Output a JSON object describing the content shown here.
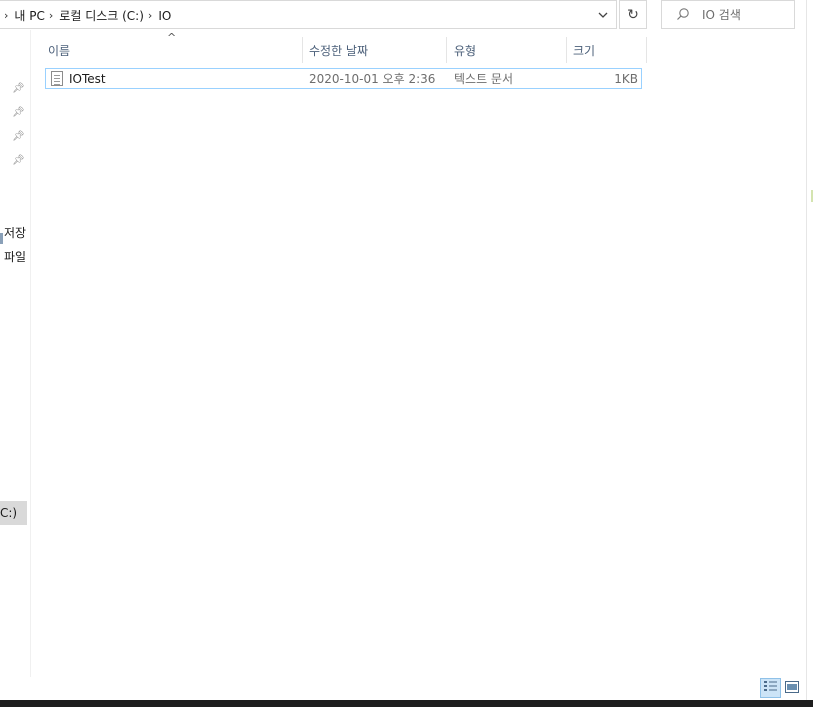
{
  "address_bar": {
    "crumbs": [
      "내 PC",
      "로컬 디스크 (C:)",
      "IO"
    ]
  },
  "search": {
    "placeholder": "IO 검색"
  },
  "nav": {
    "items": [
      "저장",
      "파일"
    ],
    "selected": "C:)"
  },
  "columns": {
    "name": "이름",
    "date_modified": "수정한 날짜",
    "type": "유형",
    "size": "크기"
  },
  "files": [
    {
      "name": "IOTest",
      "date_modified": "2020-10-01 오후 2:36",
      "type": "텍스트 문서",
      "size": "1KB",
      "icon": "text-file-icon"
    }
  ],
  "icons": {
    "refresh": "refresh-icon",
    "search": "search-icon",
    "pin": "pin-icon",
    "view_details": "details-view-icon",
    "view_thumbnails": "large-icons-view-icon"
  },
  "colors": {
    "selection_border": "#99d1ff",
    "header_text": "#4c607a",
    "view_active_bg": "#cce4f7"
  }
}
